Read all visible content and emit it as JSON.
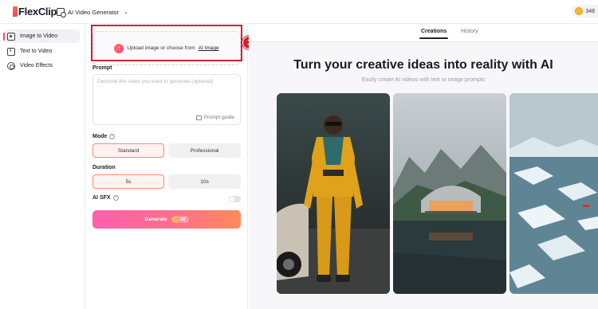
{
  "header": {
    "logo": "FlexClip",
    "tool_selector": "AI Video Generator",
    "credits": "348"
  },
  "nav": {
    "items": [
      {
        "label": "Image to Video",
        "active": true
      },
      {
        "label": "Text to Video",
        "active": false
      },
      {
        "label": "Video Effects",
        "active": false
      }
    ]
  },
  "form": {
    "upload": {
      "text": "Upload image or choose from",
      "link": "AI Image"
    },
    "step_badge": "1",
    "prompt": {
      "label": "Prompt",
      "placeholder": "Describe the video you want to generate (optional)",
      "guide": "Prompt guide"
    },
    "mode": {
      "label": "Mode",
      "options": [
        "Standard",
        "Professional"
      ],
      "selected": "Standard"
    },
    "duration": {
      "label": "Duration",
      "options": [
        "5s",
        "10s"
      ],
      "selected": "5s"
    },
    "ai_sfx": {
      "label": "AI SFX",
      "enabled": false
    },
    "generate": {
      "label": "Generate",
      "cost": "-10"
    }
  },
  "showcase": {
    "tabs": [
      "Creations",
      "History"
    ],
    "active_tab": "Creations",
    "headline": "Turn your creative ideas into reality with AI",
    "subheadline": "Easily create AI videos with text or image prompts"
  }
}
